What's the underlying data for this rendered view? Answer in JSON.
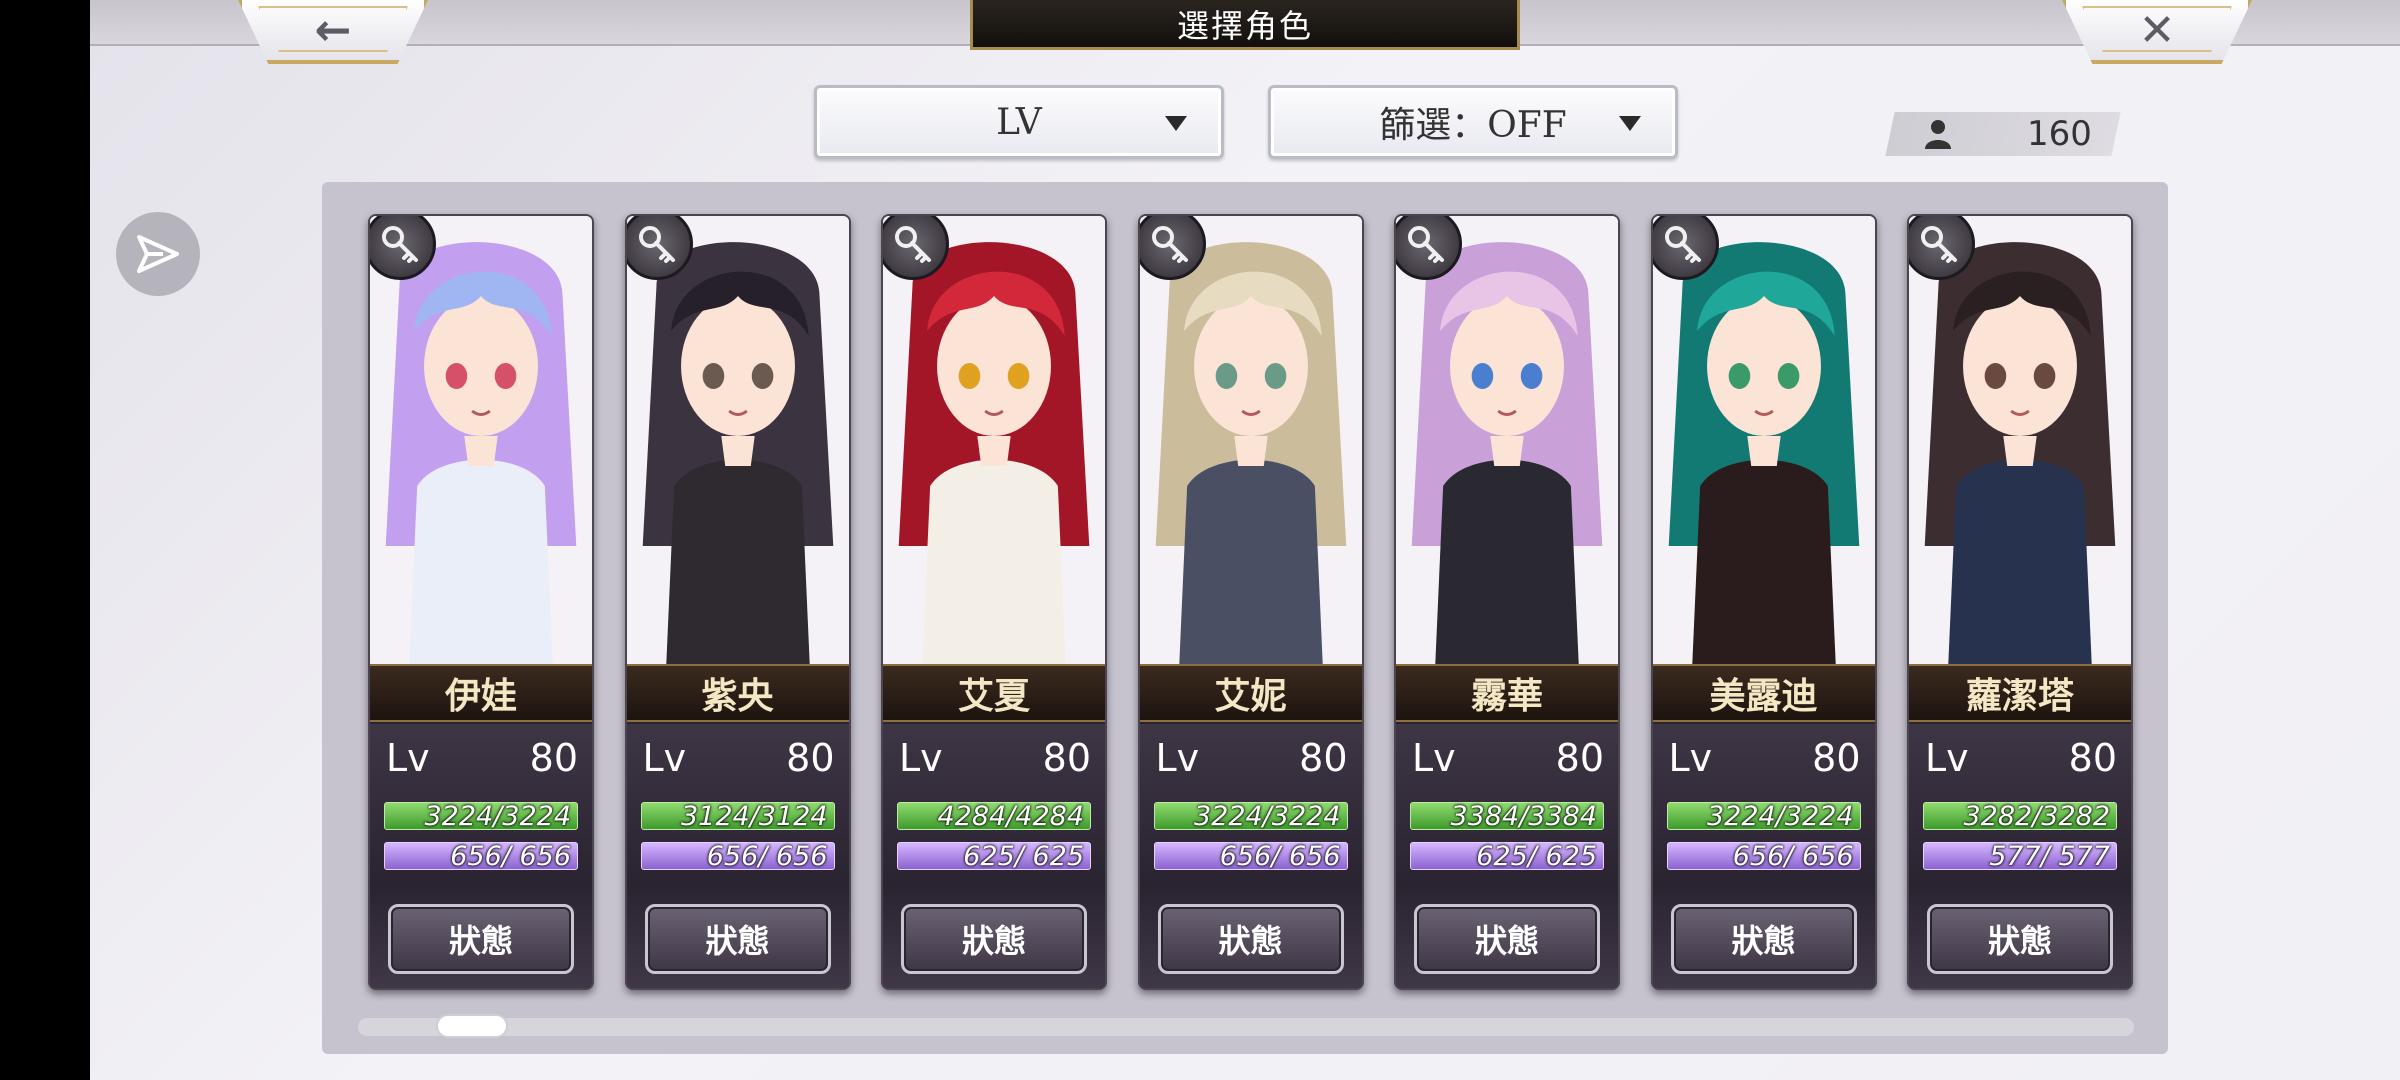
{
  "header": {
    "title": "選擇角色",
    "back_icon": "←",
    "close_icon": "✕"
  },
  "toolbar": {
    "sort_label": "LV",
    "filter_label": "篩選：OFF",
    "character_count": "160"
  },
  "status_button_label": "狀態",
  "lv_label": "Lv",
  "characters": [
    {
      "name": "伊娃",
      "level": "80",
      "hp": "3224/3224",
      "mp": "656/ 656",
      "hair": "#9fb6f2",
      "hair2": "#c39ff0",
      "outfit": "#e9eef8",
      "eye": "#d6506a"
    },
    {
      "name": "紫央",
      "level": "80",
      "hp": "3124/3124",
      "mp": "656/ 656",
      "hair": "#25202a",
      "hair2": "#3b3440",
      "outfit": "#2f2930",
      "eye": "#6a5a50"
    },
    {
      "name": "艾夏",
      "level": "80",
      "hp": "4284/4284",
      "mp": "625/ 625",
      "hair": "#d2283a",
      "hair2": "#a31628",
      "outfit": "#f4efe6",
      "eye": "#e0a020"
    },
    {
      "name": "艾妮",
      "level": "80",
      "hp": "3224/3224",
      "mp": "656/ 656",
      "hair": "#e7dcc2",
      "hair2": "#cbbd9c",
      "outfit": "#4a4f64",
      "eye": "#6a9a88"
    },
    {
      "name": "霧華",
      "level": "80",
      "hp": "3384/3384",
      "mp": "625/ 625",
      "hair": "#e8c4e6",
      "hair2": "#c9a1d8",
      "outfit": "#2a2830",
      "eye": "#4a7fd0"
    },
    {
      "name": "美露迪",
      "level": "80",
      "hp": "3224/3224",
      "mp": "656/ 656",
      "hair": "#1fa79a",
      "hair2": "#137a73",
      "outfit": "#2a1c1c",
      "eye": "#3a9a6a"
    },
    {
      "name": "蘿潔塔",
      "level": "80",
      "hp": "3282/3282",
      "mp": "577/ 577",
      "hair": "#2a2022",
      "hair2": "#3c2d30",
      "outfit": "#26324e",
      "eye": "#6a4a40"
    }
  ]
}
